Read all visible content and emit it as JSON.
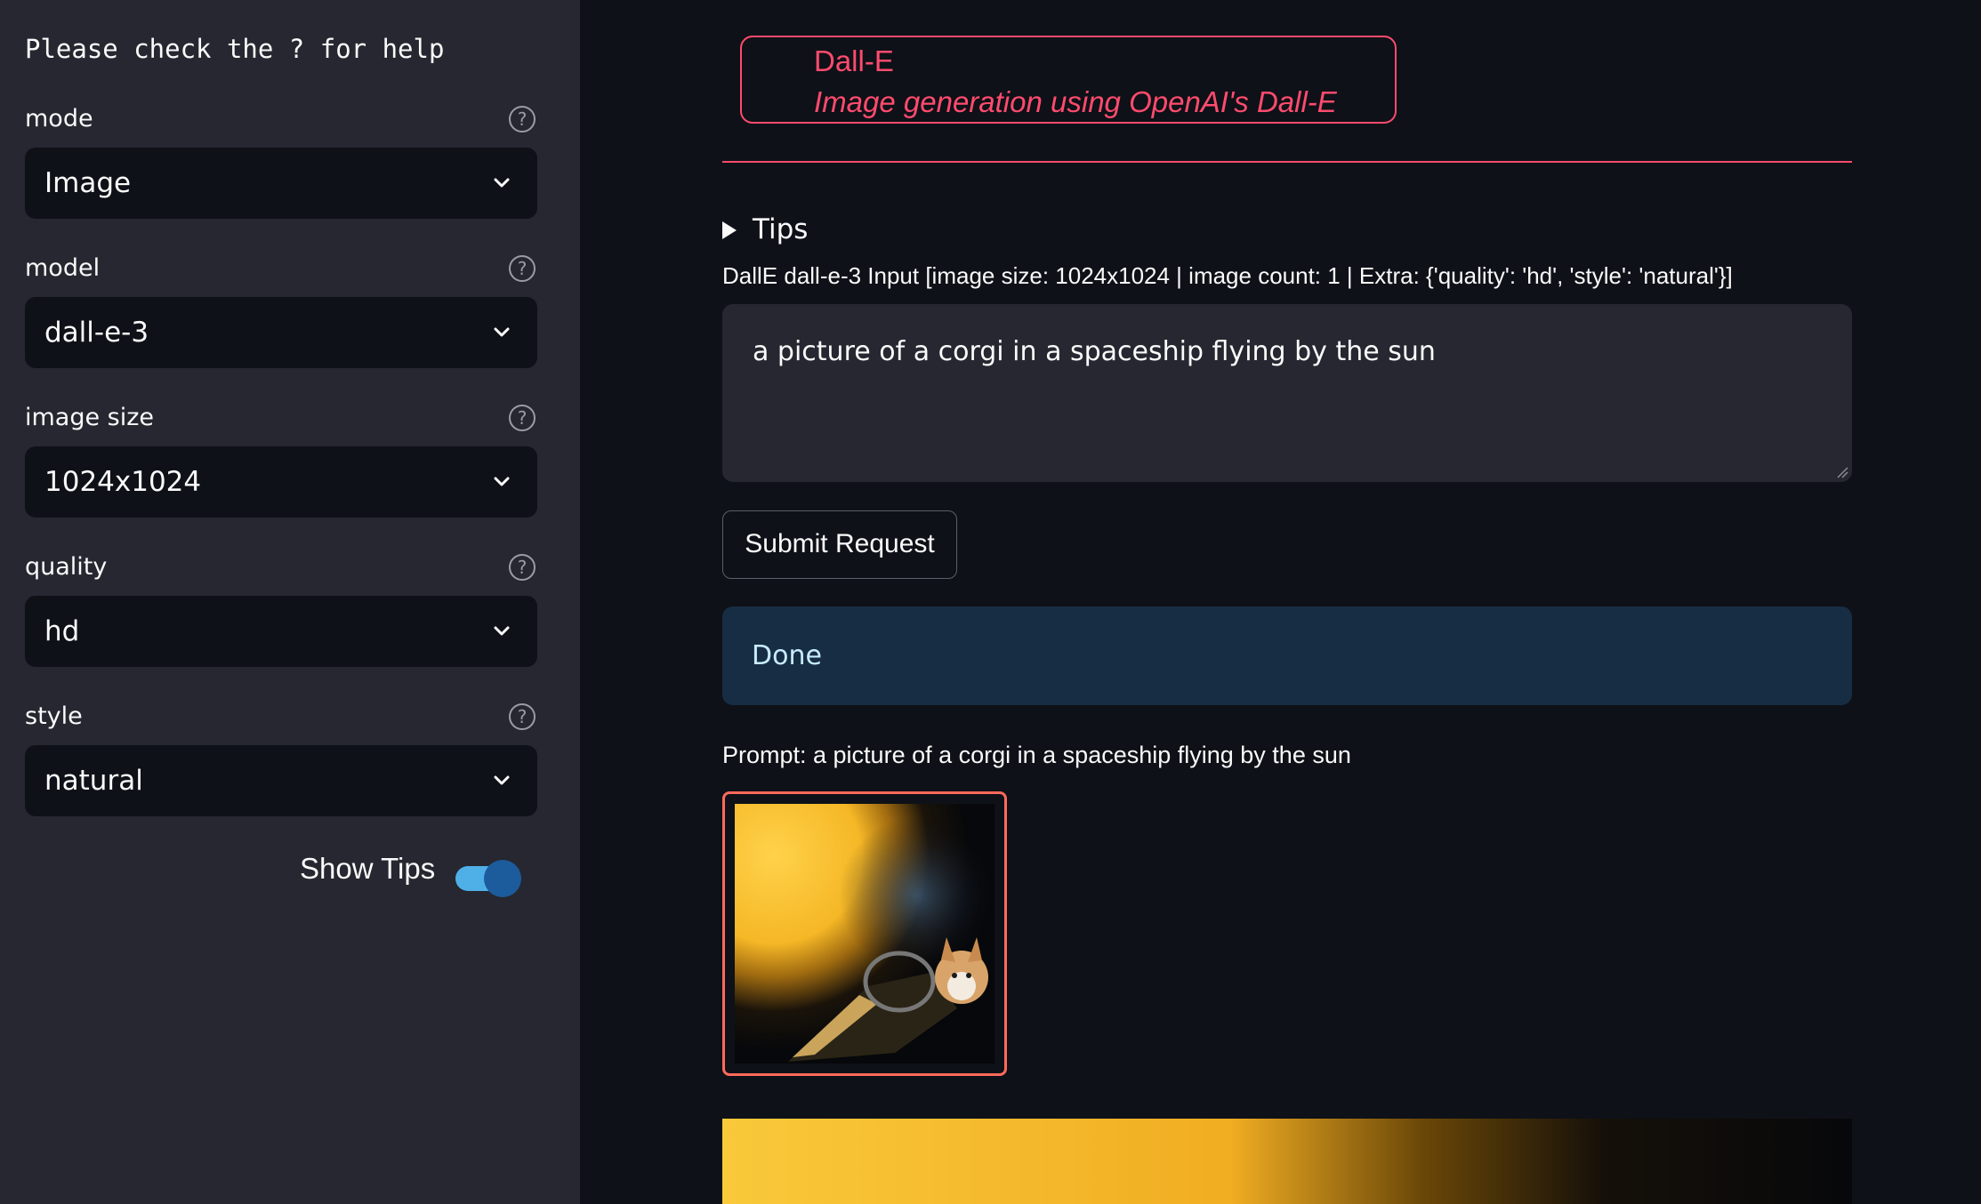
{
  "sidebar": {
    "help_note": "Please check the ? for help",
    "fields": [
      {
        "label": "mode",
        "value": "Image"
      },
      {
        "label": "model",
        "value": "dall-e-3"
      },
      {
        "label": "image size",
        "value": "1024x1024"
      },
      {
        "label": "quality",
        "value": "hd"
      },
      {
        "label": "style",
        "value": "natural"
      }
    ],
    "help_icon_glyph": "?",
    "toggle": {
      "label": "Show Tips",
      "on": true
    }
  },
  "main": {
    "header": {
      "title": "Dall-E",
      "subtitle": "Image generation using OpenAI's Dall-E"
    },
    "tips_label": "Tips",
    "input_label": "DallE dall-e-3 Input [image size: 1024x1024 | image count: 1 | Extra: {'quality': 'hd', 'style': 'natural'}]",
    "prompt_value": "a picture of a corgi in a spaceship flying by the sun",
    "submit_label": "Submit Request",
    "status_text": "Done",
    "prompt_caption": "Prompt: a picture of a corgi in a spaceship flying by the sun"
  },
  "colors": {
    "accent": "#ff4b6e",
    "sidebar_bg": "#262730",
    "main_bg": "#0e1117",
    "status_bg": "#172d43",
    "toggle_on": "#4fb0e8"
  },
  "icons": {
    "help": "question-circle-icon",
    "dropdown": "chevron-down-icon",
    "expander": "triangle-right-icon"
  }
}
